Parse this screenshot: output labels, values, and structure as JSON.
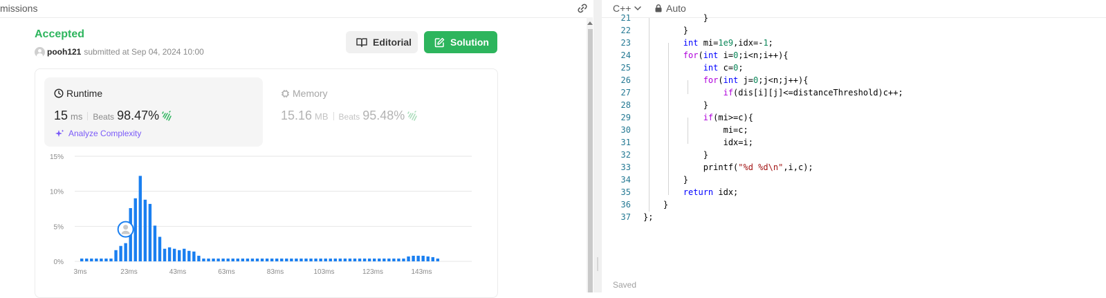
{
  "left_header": {
    "tab_label": "missions",
    "link_icon": "link-icon"
  },
  "submission": {
    "status": "Accepted",
    "username": "pooh121",
    "submitted_text": "submitted at Sep 04, 2024 10:00",
    "editorial_label": "Editorial",
    "solution_label": "Solution"
  },
  "runtime": {
    "title": "Runtime",
    "value": "15",
    "unit": "ms",
    "beats_label": "Beats",
    "percent": "98.47%",
    "analyze_label": "Analyze Complexity"
  },
  "memory": {
    "title": "Memory",
    "value": "15.16",
    "unit": "MB",
    "beats_label": "Beats",
    "percent": "95.48%"
  },
  "chart_data": {
    "type": "bar",
    "y_ticks": [
      "0%",
      "5%",
      "10%",
      "15%"
    ],
    "ylim": [
      0,
      15
    ],
    "x_ticks": [
      "3ms",
      "23ms",
      "43ms",
      "63ms",
      "83ms",
      "103ms",
      "123ms",
      "143ms"
    ],
    "values": [
      0.4,
      0.4,
      0.4,
      0.4,
      0.4,
      0.4,
      0.4,
      1.6,
      2.2,
      2.6,
      7.6,
      9.0,
      12.2,
      8.8,
      8.2,
      5.1,
      3.5,
      1.8,
      2.0,
      1.8,
      1.6,
      1.8,
      1.5,
      1.4,
      0.8,
      0.4,
      0.4,
      0.4,
      0.4,
      0.4,
      0.4,
      0.4,
      0.4,
      0.4,
      0.4,
      0.4,
      0.4,
      0.4,
      0.4,
      0.4,
      0.4,
      0.4,
      0.4,
      0.4,
      0.4,
      0.4,
      0.4,
      0.4,
      0.4,
      0.4,
      0.4,
      0.4,
      0.4,
      0.4,
      0.4,
      0.4,
      0.4,
      0.4,
      0.4,
      0.4,
      0.4,
      0.4,
      0.4,
      0.4,
      0.4,
      0.4,
      0.4,
      0.7,
      0.8,
      0.8,
      0.8,
      0.7,
      0.6,
      0.4
    ],
    "highlight_index": 9,
    "colors": {
      "bar": "#1a7ff0",
      "grid": "#e6e6e6",
      "tick": "#8a8a8a"
    }
  },
  "editor": {
    "language": "C++",
    "mode": "Auto",
    "saved_label": "Saved",
    "lines": [
      {
        "n": "21",
        "t": "            }"
      },
      {
        "n": "22",
        "t": "        }"
      },
      {
        "n": "23",
        "t": "        int mi=1e9,idx=-1;"
      },
      {
        "n": "24",
        "t": "        for(int i=0;i<n;i++){"
      },
      {
        "n": "25",
        "t": "            int c=0;"
      },
      {
        "n": "26",
        "t": "            for(int j=0;j<n;j++){"
      },
      {
        "n": "27",
        "t": "                if(dis[i][j]<=distanceThreshold)c++;"
      },
      {
        "n": "28",
        "t": "            }"
      },
      {
        "n": "29",
        "t": "            if(mi>=c){"
      },
      {
        "n": "30",
        "t": "                mi=c;"
      },
      {
        "n": "31",
        "t": "                idx=i;"
      },
      {
        "n": "32",
        "t": "            }"
      },
      {
        "n": "33",
        "t": "            printf(\"%d %d\\n\",i,c);"
      },
      {
        "n": "34",
        "t": "        }"
      },
      {
        "n": "35",
        "t": "        return idx;"
      },
      {
        "n": "36",
        "t": "    }"
      },
      {
        "n": "37",
        "t": "};"
      }
    ]
  }
}
